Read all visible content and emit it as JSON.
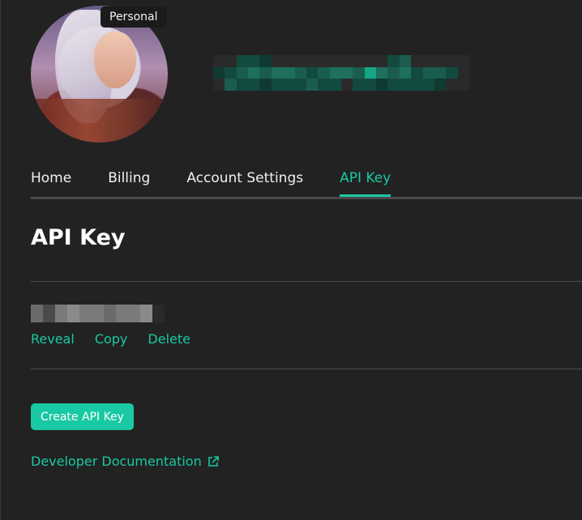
{
  "profile": {
    "badge": "Personal",
    "username_redacted": true
  },
  "tabs": [
    {
      "label": "Home",
      "active": false
    },
    {
      "label": "Billing",
      "active": false
    },
    {
      "label": "Account Settings",
      "active": false
    },
    {
      "label": "API Key",
      "active": true
    }
  ],
  "api_key_section": {
    "title": "API Key",
    "key_redacted": true,
    "actions": {
      "reveal": "Reveal",
      "copy": "Copy",
      "delete": "Delete"
    },
    "create_button": "Create API Key",
    "docs_link": "Developer Documentation",
    "docs_icon": "external-link-icon"
  },
  "colors": {
    "background": "#222222",
    "accent": "#19c9a4",
    "divider": "#4c4c4c",
    "text": "#ffffff"
  }
}
